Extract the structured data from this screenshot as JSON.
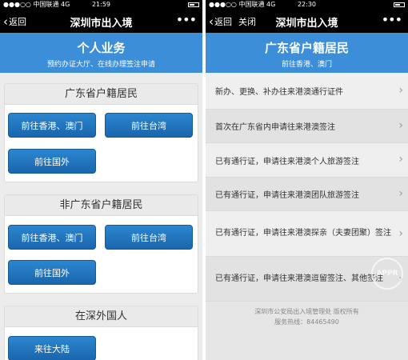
{
  "left": {
    "status": {
      "carrier": "●●●○○ 中国联通  4G",
      "time": "21:59"
    },
    "nav": {
      "back": "返回",
      "title": "深圳市出入境",
      "more": "•••"
    },
    "banner": {
      "title": "个人业务",
      "subtitle": "预约办证大厅、在线办理签注申请"
    },
    "sections": [
      {
        "title": "广东省户籍居民",
        "buttons": [
          "前往香港、澳门",
          "前往台湾",
          "前往国外"
        ]
      },
      {
        "title": "非广东省户籍居民",
        "buttons": [
          "前往香港、澳门",
          "前往台湾",
          "前往国外"
        ]
      },
      {
        "title": "在深外国人",
        "buttons": [
          "来往大陆"
        ]
      }
    ]
  },
  "right": {
    "status": {
      "carrier": "●●●○○ 中国联通  4G",
      "time": "22:30"
    },
    "nav": {
      "back": "返回",
      "close": "关闭",
      "title": "深圳市出入境",
      "more": "•••"
    },
    "banner": {
      "title": "广东省户籍居民",
      "subtitle": "前往香港、澳门"
    },
    "items": [
      "新办、更换、补办往来港澳通行证件",
      "首次在广东省内申请往来港澳签注",
      "已有通行证，申请往来港澳个人旅游签注",
      "已有通行证，申请往来港澳团队旅游签注",
      "已有通行证，申请往来港澳探亲（夫妻团聚）签注",
      "已有通行证，申请往来港澳逗留签注、其他签注"
    ],
    "footer": {
      "line1": "深圳市公安局出入境管理处 版权所有",
      "line2": "服务热线：84465490"
    },
    "watermark": "APPR"
  }
}
